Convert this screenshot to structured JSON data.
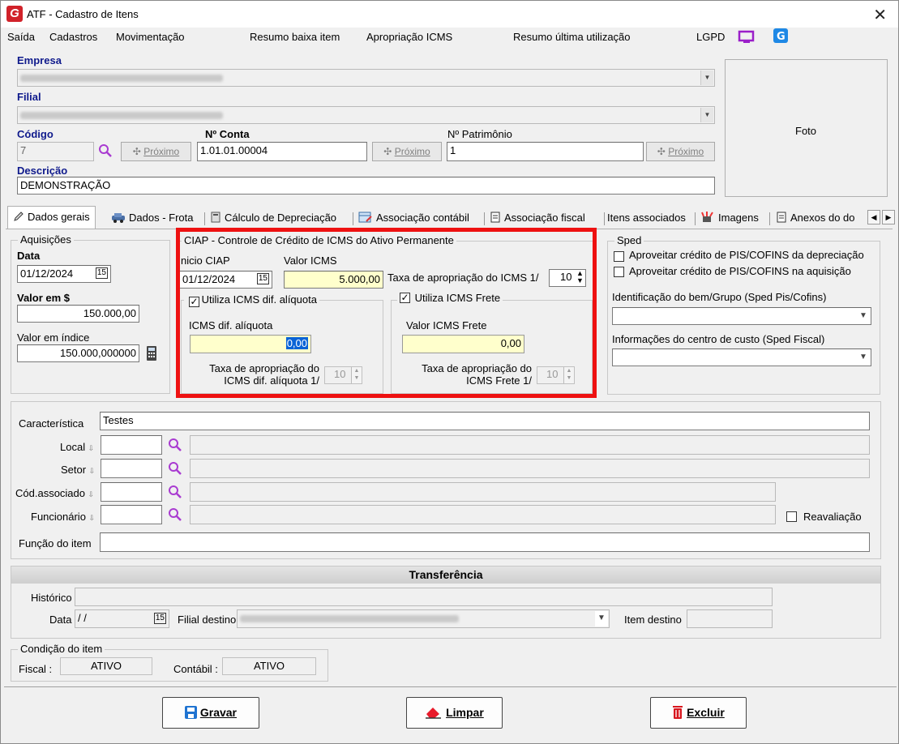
{
  "window": {
    "title": "ATF - Cadastro de Itens",
    "close": "✕"
  },
  "menu": {
    "saida": "Saída",
    "cadastros": "Cadastros",
    "movimentacao": "Movimentação",
    "resumo_baixa": "Resumo baixa item",
    "apropriacao": "Apropriação ICMS",
    "resumo_ultima": "Resumo última utilização",
    "lgpd": "LGPD"
  },
  "header": {
    "empresa_label": "Empresa",
    "filial_label": "Filial",
    "codigo_label": "Código",
    "codigo_value": "7",
    "conta_label": "Nº Conta",
    "conta_value": "1.01.01.00004",
    "patrimonio_label": "Nº Patrimônio",
    "patrimonio_value": "1",
    "proximo_label": "Próximo",
    "descricao_label": "Descrição",
    "descricao_value": "DEMONSTRAÇÃO",
    "foto_label": "Foto"
  },
  "tabs": [
    "Dados gerais",
    "Dados - Frota",
    "Cálculo de Depreciação",
    "Associação contábil",
    "Associação fiscal",
    "Itens associados",
    "Imagens",
    "Anexos do do"
  ],
  "aquisicoes": {
    "title": "Aquisições",
    "data_label": "Data",
    "data_value": "01/12/2024",
    "valor_label": "Valor em $",
    "valor_value": "150.000,00",
    "indice_label": "Valor em índice",
    "indice_value": "150.000,000000"
  },
  "ciap": {
    "title": "CIAP - Controle de Crédito de ICMS do Ativo Permanente",
    "inicio_label": "nicio CIAP",
    "inicio_value": "01/12/2024",
    "valor_icms_label": "Valor ICMS",
    "valor_icms_value": "5.000,00",
    "taxa_label": "Taxa de apropriação do ICMS 1/",
    "taxa_value": "10",
    "dif_check_label": "Utiliza ICMS dif. alíquota",
    "dif_label": "ICMS dif. alíquota",
    "dif_value": "0,00",
    "dif_taxa_label_1": "Taxa de apropriação do",
    "dif_taxa_label_2": "ICMS dif. alíquota 1/",
    "dif_taxa_value": "10",
    "frete_check_label": "Utiliza ICMS Frete",
    "frete_label": "Valor ICMS Frete",
    "frete_value": "0,00",
    "frete_taxa_label_1": "Taxa de apropriação do",
    "frete_taxa_label_2": "ICMS Frete 1/",
    "frete_taxa_value": "10"
  },
  "sped": {
    "title": "Sped",
    "pis_depreciacao": "Aproveitar crédito de PIS/COFINS da depreciação",
    "pis_aquisicao": "Aproveitar crédito de PIS/COFINS na aquisição",
    "identificacao_label": "Identificação do bem/Grupo (Sped Pis/Cofins)",
    "centro_custo_label": "Informações do centro de custo (Sped Fiscal)"
  },
  "details": {
    "caracteristica_label": "Característica",
    "caracteristica_value": "Testes",
    "local_label": "Local",
    "setor_label": "Setor",
    "cod_associado_label": "Cód.associado",
    "funcionario_label": "Funcionário",
    "reavaliacao_label": "Reavaliação",
    "funcao_label": "Função do item"
  },
  "transferencia": {
    "title": "Transferência",
    "historico_label": "Histórico",
    "data_label": "Data",
    "data_value": " /  /",
    "filial_destino_label": "Filial destino",
    "item_destino_label": "Item destino"
  },
  "condicao": {
    "title": "Condição do item",
    "fiscal_label": "Fiscal :",
    "fiscal_value": "ATIVO",
    "contabil_label": "Contábil :",
    "contabil_value": "ATIVO"
  },
  "buttons": {
    "gravar": "Gravar",
    "limpar": "Limpar",
    "excluir": "Excluir"
  },
  "colors": {
    "highlight": "#ee1111",
    "label_blue": "#0f1a8c",
    "yellow_field": "#ffffcc"
  }
}
